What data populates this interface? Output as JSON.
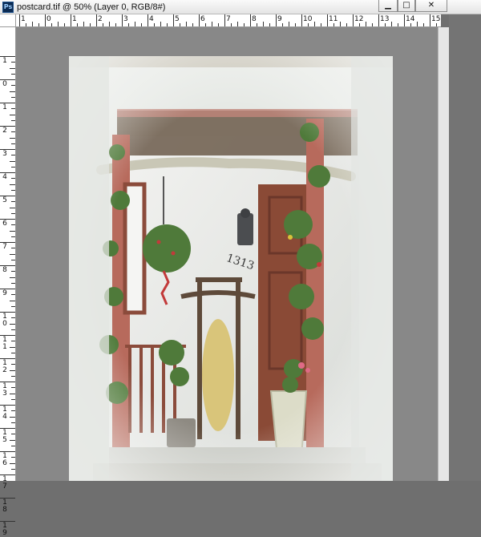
{
  "window": {
    "title": "postcard.tif @ 50% (Layer 0, RGB/8#)",
    "app_icon": "Ps",
    "buttons": {
      "minimize_glyph": "▁",
      "maximize_glyph": "□",
      "close_glyph": "✕"
    }
  },
  "ruler_horizontal": [
    "1",
    "0",
    "1",
    "2",
    "3",
    "4",
    "5",
    "6",
    "7",
    "8",
    "9",
    "10",
    "11",
    "12",
    "13",
    "14",
    "15"
  ],
  "ruler_vertical": [
    "1",
    "0",
    "1",
    "2",
    "3",
    "4",
    "5",
    "6",
    "7",
    "8",
    "9",
    "10",
    "11",
    "12",
    "13",
    "14",
    "15",
    "16",
    "17",
    "18",
    "19"
  ],
  "artwork": {
    "house_number": "1313"
  },
  "colors": {
    "canvas_background": "#888888",
    "app_background": "#6f6f6f",
    "door": "#8a4a36",
    "post": "#b76a5c",
    "sled_runner": "#5e4a3a",
    "sled_slats": "#d9c57a",
    "greenery": "#4f7a3a"
  }
}
